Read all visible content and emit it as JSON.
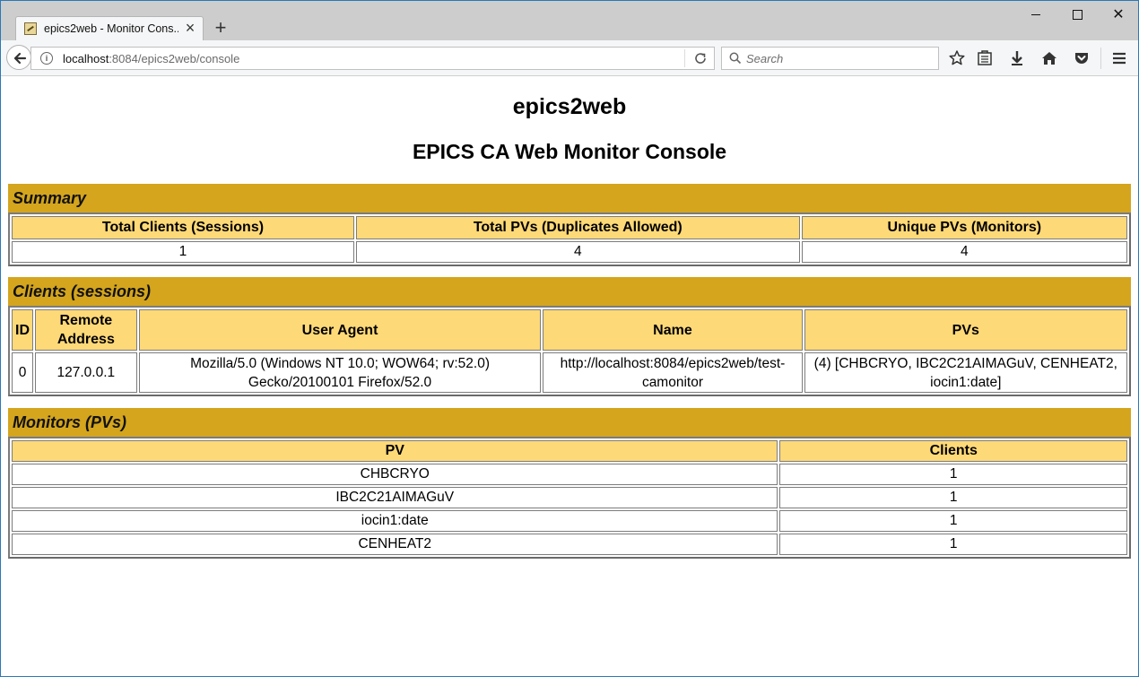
{
  "browser": {
    "tab_title": "epics2web - Monitor Cons...",
    "url_host": "localhost",
    "url_path": ":8084/epics2web/console",
    "search_placeholder": "Search"
  },
  "page": {
    "site_title": "epics2web",
    "console_title": "EPICS CA Web Monitor Console"
  },
  "summary": {
    "heading": "Summary",
    "headers": [
      "Total Clients (Sessions)",
      "Total PVs (Duplicates Allowed)",
      "Unique PVs (Monitors)"
    ],
    "values": [
      "1",
      "4",
      "4"
    ]
  },
  "clients": {
    "heading": "Clients (sessions)",
    "headers": [
      "ID",
      "Remote Address",
      "User Agent",
      "Name",
      "PVs"
    ],
    "rows": [
      [
        "0",
        "127.0.0.1",
        "Mozilla/5.0 (Windows NT 10.0; WOW64; rv:52.0) Gecko/20100101 Firefox/52.0",
        "http://localhost:8084/epics2web/test-camonitor",
        "(4) [CHBCRYO, IBC2C21AIMAGuV, CENHEAT2, iocin1:date]"
      ]
    ]
  },
  "monitors": {
    "heading": "Monitors (PVs)",
    "headers": [
      "PV",
      "Clients"
    ],
    "rows": [
      [
        "CHBCRYO",
        "1"
      ],
      [
        "IBC2C21AIMAGuV",
        "1"
      ],
      [
        "iocin1:date",
        "1"
      ],
      [
        "CENHEAT2",
        "1"
      ]
    ]
  },
  "colors": {
    "section_header": "#d4a51d",
    "table_header": "#fed978",
    "window_border": "#2b79b8"
  }
}
